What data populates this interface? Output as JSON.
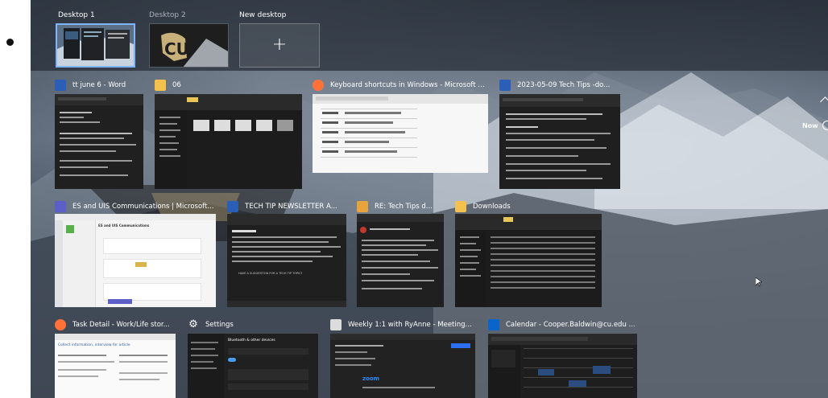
{
  "desktops": [
    {
      "label": "Desktop 1",
      "selected": true
    },
    {
      "label": "Desktop 2",
      "selected": false
    },
    {
      "label": "New desktop",
      "selected": false
    }
  ],
  "new_desktop_symbol": "+",
  "windows": [
    {
      "title": "tt june 6 - Word",
      "icon": "word-icon"
    },
    {
      "title": "06",
      "icon": "folder-icon"
    },
    {
      "title": "Keyboard shortcuts in Windows - Microsoft S...",
      "icon": "firefox-icon"
    },
    {
      "title": "2023-05-09 Tech Tips -do...",
      "icon": "word-icon"
    },
    {
      "title": "ES and UIS Communications | Microsoft...",
      "icon": "teams-icon"
    },
    {
      "title": "TECH TIP NEWSLETTER A...",
      "icon": "word-icon"
    },
    {
      "title": "RE: Tech Tips d...",
      "icon": "mail-icon"
    },
    {
      "title": "Downloads",
      "icon": "folder-icon"
    },
    {
      "title": "Task Detail - Work/Life stor...",
      "icon": "firefox-icon"
    },
    {
      "title": "Settings",
      "icon": "gear-icon"
    },
    {
      "title": "Weekly 1:1 with RyAnne - Meeting...",
      "icon": "zoom-icon"
    },
    {
      "title": "Calendar - Cooper.Baldwin@cu.edu - Outlook",
      "icon": "outlook-icon"
    }
  ],
  "side_label": "Now",
  "thumb_text": {
    "teams_heading": "ES and UIS Communications",
    "settings_heading": "Bluetooth & other devices",
    "zoom_logo": "zoom",
    "task_heading": "Collect information, interview for article",
    "newsletter_footer": "HAVE A SUGGESTION FOR A TECH TIP TOPIC?"
  }
}
